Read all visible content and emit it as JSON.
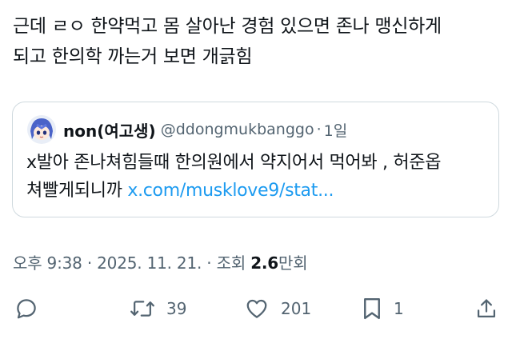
{
  "tweet": {
    "text_lines": [
      "근데 ㄹㅇ 한약먹고 몸 살아난 경험 있으면 존나 맹신하게",
      "되고 한의학 까는거 보면 개긁힘"
    ]
  },
  "quote": {
    "author_name": "non(여고생)",
    "author_handle": "@ddongmukbanggo",
    "separator": "·",
    "time": "1일",
    "text_line1": "x발아 존나쳐힘들때 한의원에서 약지어서 먹어봐 , 허준옵",
    "text_line2": "쳐빨게되니까",
    "link": "x.com/musklove9/stat..."
  },
  "meta": {
    "time": "오후 9:38",
    "sep1": " · ",
    "date": "2025. 11. 21.",
    "sep2": " · ",
    "views_label": "조회 ",
    "views_count": "2.6",
    "views_unit": "만회"
  },
  "actions": {
    "reply_icon": "reply-icon",
    "retweet_icon": "retweet-icon",
    "retweet_count": "39",
    "like_icon": "heart-icon",
    "like_count": "201",
    "bookmark_icon": "bookmark-icon",
    "bookmark_count": "1",
    "share_icon": "share-icon"
  },
  "colors": {
    "text": "#0f1419",
    "secondary": "#536471",
    "link": "#1d9bf0",
    "border": "#cfd9de"
  }
}
